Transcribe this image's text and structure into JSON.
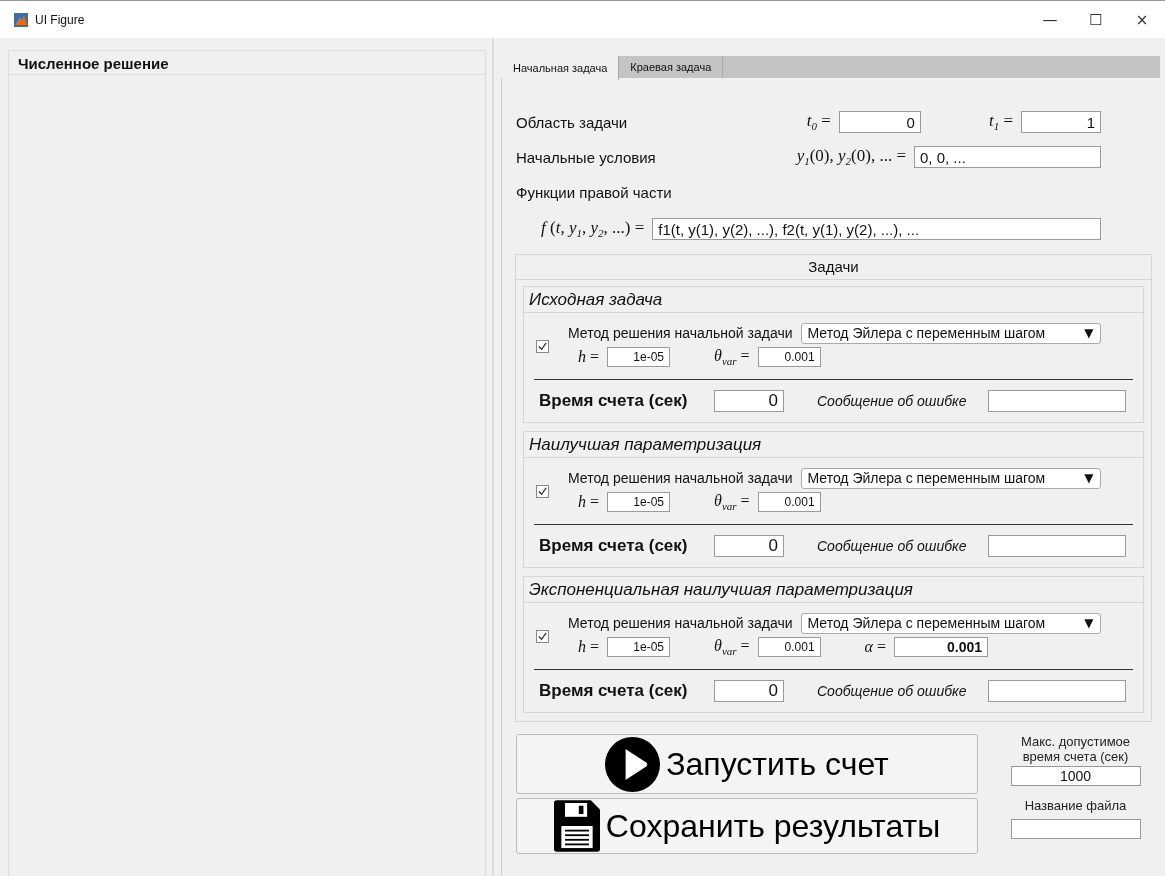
{
  "window": {
    "title": "UI Figure",
    "controls": [
      "—",
      "☐",
      "×"
    ]
  },
  "left_panel": {
    "title": "Численное решение"
  },
  "tabs": [
    {
      "label": "Начальная задача",
      "selected": true
    },
    {
      "label": "Краевая задача",
      "selected": false
    }
  ],
  "domain": {
    "label": "Область задачи",
    "t0_label": "*t*$_{0}$ =",
    "t0": "0",
    "t1_label": "*t*$_{1}$ =",
    "t1": "1"
  },
  "initial": {
    "label": "Начальные условия",
    "math": "*y*$_{1}$(0), *y*$_{2}$(0), ... =",
    "value": "0, 0, ..."
  },
  "rhs": {
    "label": "Функции правой части",
    "math": "*f* (*t*, *y*$_{1}$, *y*$_{2}$, ...) =",
    "value": "f1(t, y(1), y(2), ...), f2(t, y(1), y(2), ...), ..."
  },
  "tasks_panel": {
    "title": "Задачи",
    "tasks": [
      {
        "title": "Исходная задача",
        "checked": true,
        "method_label": "Метод решения начальной задачи",
        "method": "Метод Эйлера с переменным шагом",
        "caret": "▼",
        "params": [
          {
            "symbol": "*h* =",
            "value": "1e-05",
            "bold": false
          },
          {
            "symbol": "*θ*$_{var}$ =",
            "value": "0.001",
            "bold": false
          }
        ],
        "time_label": "Время счета (сек)",
        "time": "0",
        "error_label": "Сообщение об ошибке"
      },
      {
        "title": "Наилучшая параметризация",
        "checked": true,
        "method_label": "Метод решения начальной задачи",
        "method": "Метод Эйлера с переменным шагом",
        "caret": "▼",
        "params": [
          {
            "symbol": "*h* =",
            "value": "1e-05",
            "bold": false
          },
          {
            "symbol": "*θ*$_{var}$ =",
            "value": "0.001",
            "bold": false
          }
        ],
        "time_label": "Время счета (сек)",
        "time": "0",
        "error_label": "Сообщение об ошибке"
      },
      {
        "title": "Экспоненциальная наилучшая параметризация",
        "checked": true,
        "method_label": "Метод решения начальной задачи",
        "method": "Метод Эйлера с переменным шагом",
        "caret": "▼",
        "params": [
          {
            "symbol": "*h* =",
            "value": "1e-05",
            "bold": false
          },
          {
            "symbol": "*θ*$_{var}$ =",
            "value": "0.001",
            "bold": false
          },
          {
            "symbol": "*α* =",
            "value": "0.001",
            "bold": true
          }
        ],
        "time_label": "Время счета (сек)",
        "time": "0",
        "error_label": "Сообщение об ошибке"
      }
    ]
  },
  "run_button": {
    "label": "Запустить счет"
  },
  "save_button": {
    "label": "Сохранить результаты"
  },
  "max_time": {
    "label": "Макс. допустимое время счета (сек)",
    "value": "1000"
  },
  "file_name": {
    "label": "Название файла"
  }
}
